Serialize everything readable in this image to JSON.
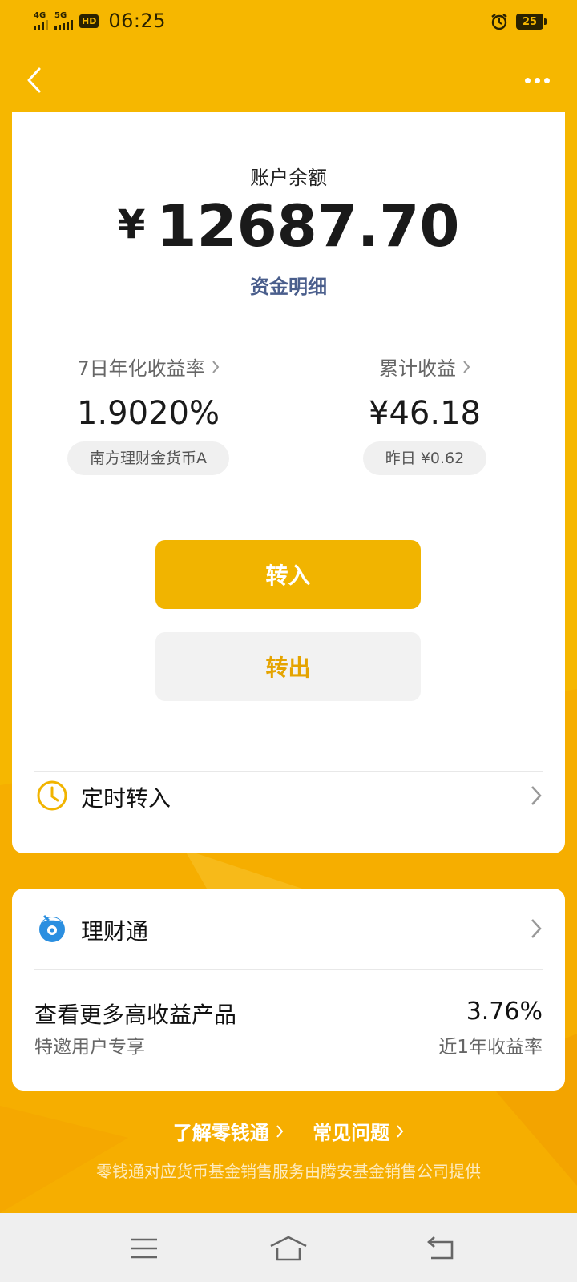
{
  "status_bar": {
    "network1": "4G",
    "network2": "5G",
    "hd": "HD",
    "time": "06:25",
    "battery": "25"
  },
  "account": {
    "label": "账户余额",
    "currency": "¥",
    "balance": "12687.70",
    "detail_link": "资金明细"
  },
  "stats": {
    "yield_title": "7日年化收益率",
    "yield_value": "1.9020%",
    "fund_name": "南方理财金货币A",
    "cumulative_title": "累计收益",
    "cumulative_value": "¥46.18",
    "yesterday": "昨日 ¥0.62"
  },
  "actions": {
    "transfer_in": "转入",
    "transfer_out": "转出"
  },
  "scheduled": {
    "label": "定时转入"
  },
  "licaitong": {
    "label": "理财通",
    "promo_title": "查看更多高收益产品",
    "promo_sub": "特邀用户专享",
    "promo_rate": "3.76%",
    "promo_rate_label": "近1年收益率"
  },
  "footer": {
    "link1": "了解零钱通",
    "link2": "常见问题",
    "note": "零钱通对应货币基金销售服务由腾安基金销售公司提供"
  },
  "colors": {
    "background": "#F6B700",
    "primary_button": "#F1B400",
    "link_blue": "#4A5E8C"
  }
}
